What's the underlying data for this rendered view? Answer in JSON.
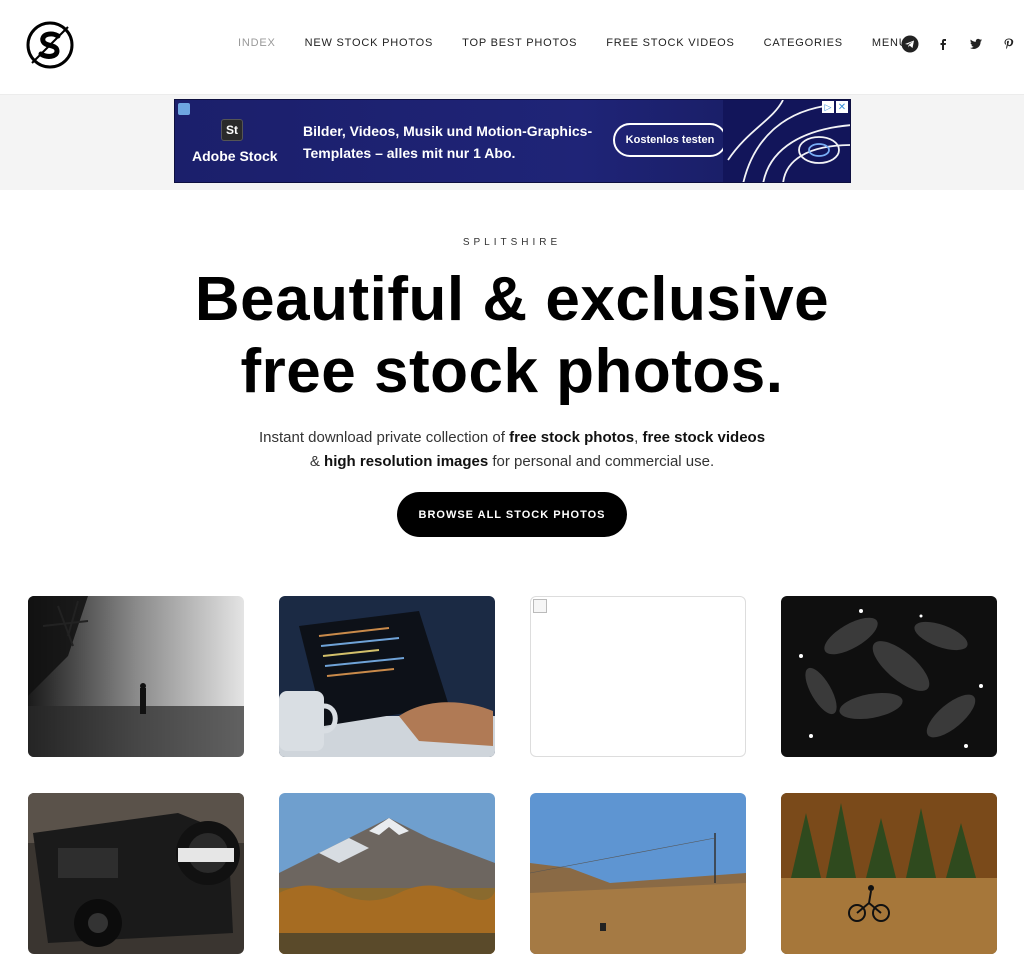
{
  "header": {
    "nav": [
      {
        "label": "INDEX",
        "active": true
      },
      {
        "label": "NEW STOCK PHOTOS",
        "active": false
      },
      {
        "label": "TOP BEST PHOTOS",
        "active": false
      },
      {
        "label": "FREE STOCK VIDEOS",
        "active": false
      },
      {
        "label": "CATEGORIES",
        "active": false
      },
      {
        "label": "MENU",
        "active": false
      }
    ],
    "social_icons": [
      "telegram-icon",
      "facebook-icon",
      "twitter-icon",
      "pinterest-icon"
    ]
  },
  "ad": {
    "logo_mark": "St",
    "brand": "Adobe Stock",
    "text": "Bilder, Videos, Musik und Motion-Graphics-Templates – alles mit nur 1 Abo.",
    "cta": "Kostenlos testen",
    "info_glyph": "▷",
    "close_glyph": "✕"
  },
  "hero": {
    "kicker": "SPLITSHIRE",
    "headline_line1": "Beautiful & exclusive",
    "headline_line2": "free stock photos.",
    "sub_part1": "Instant download private collection of ",
    "sub_bold1": "free stock photos",
    "sub_part2": ", ",
    "sub_bold2": "free stock videos",
    "sub_part3": "& ",
    "sub_bold3": "high resolution images",
    "sub_part4": " for personal and commercial use.",
    "cta": "BROWSE ALL STOCK PHOTOS"
  },
  "colors": {
    "ad_background": "#1f2477",
    "cta_background": "#000000",
    "nav_active": "#999999"
  },
  "gallery": [
    {
      "subject": "foggy-street"
    },
    {
      "subject": "laptop-coding"
    },
    {
      "subject": "broken-image"
    },
    {
      "subject": "dark-leaves"
    },
    {
      "subject": "black-jeep"
    },
    {
      "subject": "snowy-mountain"
    },
    {
      "subject": "hillside-trail"
    },
    {
      "subject": "cyclist-forest"
    }
  ]
}
